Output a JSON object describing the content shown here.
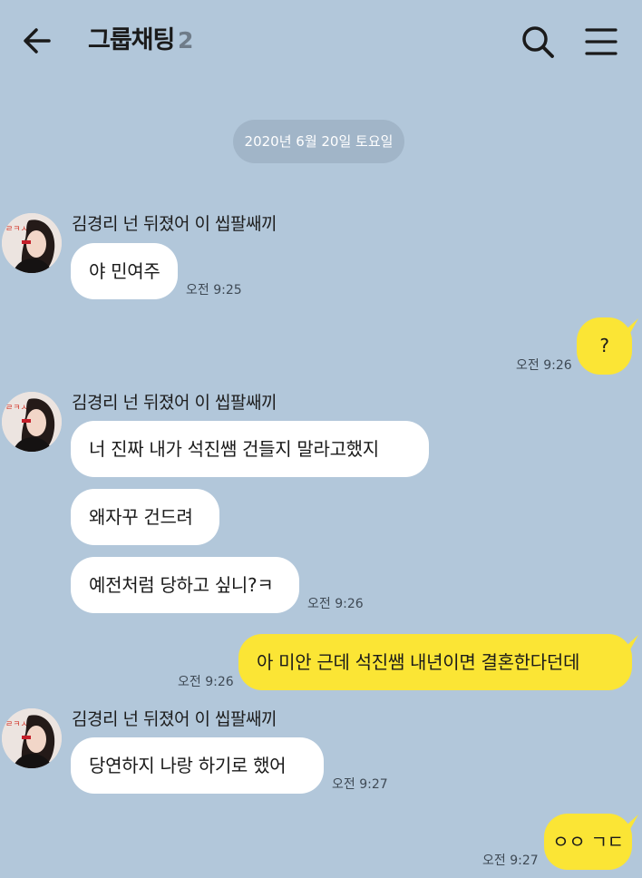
{
  "header": {
    "title": "그룹채팅",
    "member_count": "2"
  },
  "date_divider": "2020년 6월 20일 토요일",
  "sender_name": "김경리 넌 뒤졌어 이 씹팔쌔끼",
  "messages": [
    {
      "text": "야 민여주",
      "time": "오전 9:25"
    },
    {
      "text": "?",
      "time": "오전 9:26"
    },
    {
      "text": "너 진짜 내가 석진쌤 건들지 말라고했지"
    },
    {
      "text": "왜자꾸 건드려"
    },
    {
      "text": "예전처럼 당하고 싶니?ㅋ",
      "time": "오전 9:26"
    },
    {
      "text": "아 미안 근데 석진쌤 내년이면 결혼한다던데",
      "time": "오전 9:26"
    },
    {
      "text": "당연하지 나랑 하기로 했어",
      "time": "오전 9:27"
    },
    {
      "text": "ㅇㅇ ㄱㄷ",
      "time": "오전 9:27"
    }
  ],
  "colors": {
    "background": "#b2c7da",
    "incoming_bubble": "#ffffff",
    "outgoing_bubble": "#fbe535",
    "date_pill": "#a1b5c8"
  },
  "icons": [
    "back-arrow-icon",
    "search-icon",
    "menu-icon"
  ]
}
